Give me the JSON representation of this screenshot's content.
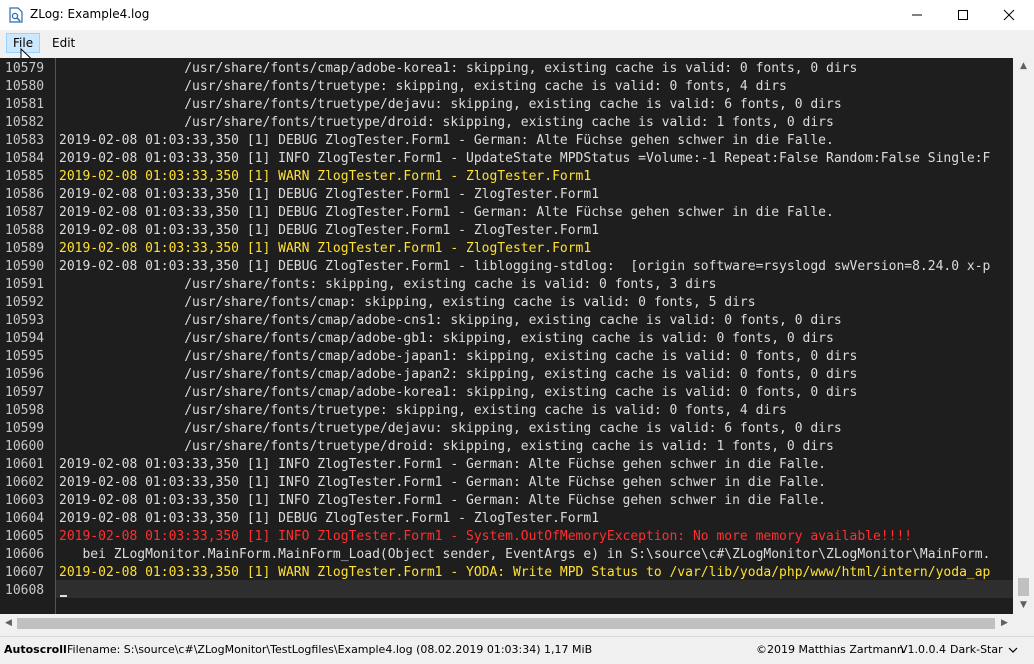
{
  "window": {
    "title": "ZLog: Example4.log",
    "icons": {
      "app": "document-search-icon",
      "minimize": "minimize-icon",
      "maximize": "maximize-icon",
      "close": "close-icon"
    }
  },
  "menu": {
    "file": "File",
    "edit": "Edit"
  },
  "log": {
    "lines": [
      {
        "n": "10579",
        "level": "info",
        "text": "                /usr/share/fonts/cmap/adobe-korea1: skipping, existing cache is valid: 0 fonts, 0 dirs"
      },
      {
        "n": "10580",
        "level": "info",
        "text": "                /usr/share/fonts/truetype: skipping, existing cache is valid: 0 fonts, 4 dirs"
      },
      {
        "n": "10581",
        "level": "info",
        "text": "                /usr/share/fonts/truetype/dejavu: skipping, existing cache is valid: 6 fonts, 0 dirs"
      },
      {
        "n": "10582",
        "level": "info",
        "text": "                /usr/share/fonts/truetype/droid: skipping, existing cache is valid: 1 fonts, 0 dirs"
      },
      {
        "n": "10583",
        "level": "debug",
        "text": "2019-02-08 01:03:33,350 [1] DEBUG ZlogTester.Form1 - German: Alte Füchse gehen schwer in die Falle."
      },
      {
        "n": "10584",
        "level": "info",
        "text": "2019-02-08 01:03:33,350 [1] INFO ZlogTester.Form1 - UpdateState MPDStatus =Volume:-1 Repeat:False Random:False Single:F"
      },
      {
        "n": "10585",
        "level": "warn",
        "text": "2019-02-08 01:03:33,350 [1] WARN ZlogTester.Form1 - ZlogTester.Form1"
      },
      {
        "n": "10586",
        "level": "debug",
        "text": "2019-02-08 01:03:33,350 [1] DEBUG ZlogTester.Form1 - ZlogTester.Form1"
      },
      {
        "n": "10587",
        "level": "debug",
        "text": "2019-02-08 01:03:33,350 [1] DEBUG ZlogTester.Form1 - German: Alte Füchse gehen schwer in die Falle."
      },
      {
        "n": "10588",
        "level": "debug",
        "text": "2019-02-08 01:03:33,350 [1] DEBUG ZlogTester.Form1 - ZlogTester.Form1"
      },
      {
        "n": "10589",
        "level": "warn",
        "text": "2019-02-08 01:03:33,350 [1] WARN ZlogTester.Form1 - ZlogTester.Form1"
      },
      {
        "n": "10590",
        "level": "debug",
        "text": "2019-02-08 01:03:33,350 [1] DEBUG ZlogTester.Form1 - liblogging-stdlog:  [origin software=rsyslogd swVersion=8.24.0 x-p"
      },
      {
        "n": "10591",
        "level": "info",
        "text": "                /usr/share/fonts: skipping, existing cache is valid: 0 fonts, 3 dirs"
      },
      {
        "n": "10592",
        "level": "info",
        "text": "                /usr/share/fonts/cmap: skipping, existing cache is valid: 0 fonts, 5 dirs"
      },
      {
        "n": "10593",
        "level": "info",
        "text": "                /usr/share/fonts/cmap/adobe-cns1: skipping, existing cache is valid: 0 fonts, 0 dirs"
      },
      {
        "n": "10594",
        "level": "info",
        "text": "                /usr/share/fonts/cmap/adobe-gb1: skipping, existing cache is valid: 0 fonts, 0 dirs"
      },
      {
        "n": "10595",
        "level": "info",
        "text": "                /usr/share/fonts/cmap/adobe-japan1: skipping, existing cache is valid: 0 fonts, 0 dirs"
      },
      {
        "n": "10596",
        "level": "info",
        "text": "                /usr/share/fonts/cmap/adobe-japan2: skipping, existing cache is valid: 0 fonts, 0 dirs"
      },
      {
        "n": "10597",
        "level": "info",
        "text": "                /usr/share/fonts/cmap/adobe-korea1: skipping, existing cache is valid: 0 fonts, 0 dirs"
      },
      {
        "n": "10598",
        "level": "info",
        "text": "                /usr/share/fonts/truetype: skipping, existing cache is valid: 0 fonts, 4 dirs"
      },
      {
        "n": "10599",
        "level": "info",
        "text": "                /usr/share/fonts/truetype/dejavu: skipping, existing cache is valid: 6 fonts, 0 dirs"
      },
      {
        "n": "10600",
        "level": "info",
        "text": "                /usr/share/fonts/truetype/droid: skipping, existing cache is valid: 1 fonts, 0 dirs"
      },
      {
        "n": "10601",
        "level": "info",
        "text": "2019-02-08 01:03:33,350 [1] INFO ZlogTester.Form1 - German: Alte Füchse gehen schwer in die Falle."
      },
      {
        "n": "10602",
        "level": "info",
        "text": "2019-02-08 01:03:33,350 [1] INFO ZlogTester.Form1 - German: Alte Füchse gehen schwer in die Falle."
      },
      {
        "n": "10603",
        "level": "info",
        "text": "2019-02-08 01:03:33,350 [1] INFO ZlogTester.Form1 - German: Alte Füchse gehen schwer in die Falle."
      },
      {
        "n": "10604",
        "level": "debug",
        "text": "2019-02-08 01:03:33,350 [1] DEBUG ZlogTester.Form1 - ZlogTester.Form1"
      },
      {
        "n": "10605",
        "level": "error",
        "text": "2019-02-08 01:03:33,350 [1] INFO ZlogTester.Form1 - System.OutOfMemoryException: No more memory available!!!!"
      },
      {
        "n": "10606",
        "level": "info",
        "text": "   bei ZLogMonitor.MainForm.MainForm_Load(Object sender, EventArgs e) in S:\\source\\c#\\ZLogMonitor\\ZLogMonitor\\MainForm."
      },
      {
        "n": "10607",
        "level": "warn",
        "text": "2019-02-08 01:03:33,350 [1] WARN ZlogTester.Form1 - YODA: Write MPD Status to /var/lib/yoda/php/www/html/intern/yoda_ap"
      },
      {
        "n": "10608",
        "level": "info",
        "text": ""
      }
    ]
  },
  "status": {
    "autoscroll": "Autoscroll",
    "filename": "Filename: S:\\source\\c#\\ZLogMonitor\\TestLogfiles\\Example4.log (08.02.2019 01:03:34) 1,17 MiB",
    "copyright": "©2019 Matthias Zartmann",
    "version": "V1.0.0.4",
    "theme": "Dark-Star"
  },
  "colors": {
    "background": "#1e1e1e",
    "text": "#dcdcdc",
    "warn": "#ffe033",
    "error": "#ff3030"
  }
}
